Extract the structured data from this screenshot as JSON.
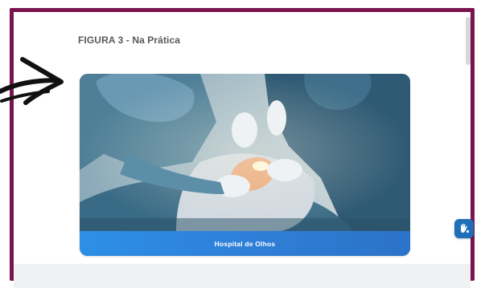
{
  "figure": {
    "title": "FIGURA 3 - Na Prática",
    "caption": "Hospital de Olhos"
  },
  "icons": {
    "arrow": "hand-drawn-arrow-icon",
    "accessibility": "hand-sign-icon"
  },
  "colors": {
    "frame_border": "#7a1450",
    "caption_bar": "#2f7fd8",
    "title_text": "#555a60",
    "libras_button": "#1f6fb8"
  }
}
